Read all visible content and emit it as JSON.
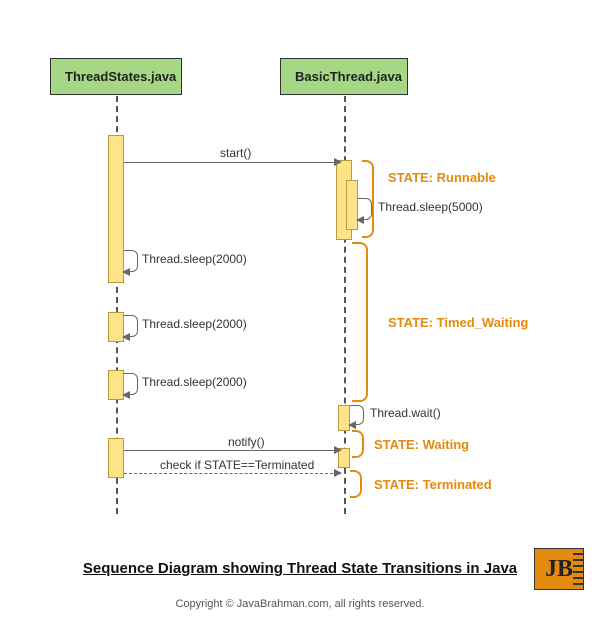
{
  "participants": {
    "left": "ThreadStates.java",
    "right": "BasicThread.java"
  },
  "messages": {
    "start": "start()",
    "sleep5000": "Thread.sleep(5000)",
    "sleep2000_a": "Thread.sleep(2000)",
    "sleep2000_b": "Thread.sleep(2000)",
    "sleep2000_c": "Thread.sleep(2000)",
    "wait": "Thread.wait()",
    "notify": "notify()",
    "check": "check if STATE==Terminated"
  },
  "states": {
    "runnable": "STATE: Runnable",
    "timed_waiting": "STATE: Timed_Waiting",
    "waiting": "STATE: Waiting",
    "terminated": "STATE: Terminated"
  },
  "title": "Sequence Diagram showing Thread State Transitions in Java",
  "copyright": "Copyright © JavaBrahman.com, all rights reserved.",
  "logo_text": "JB"
}
